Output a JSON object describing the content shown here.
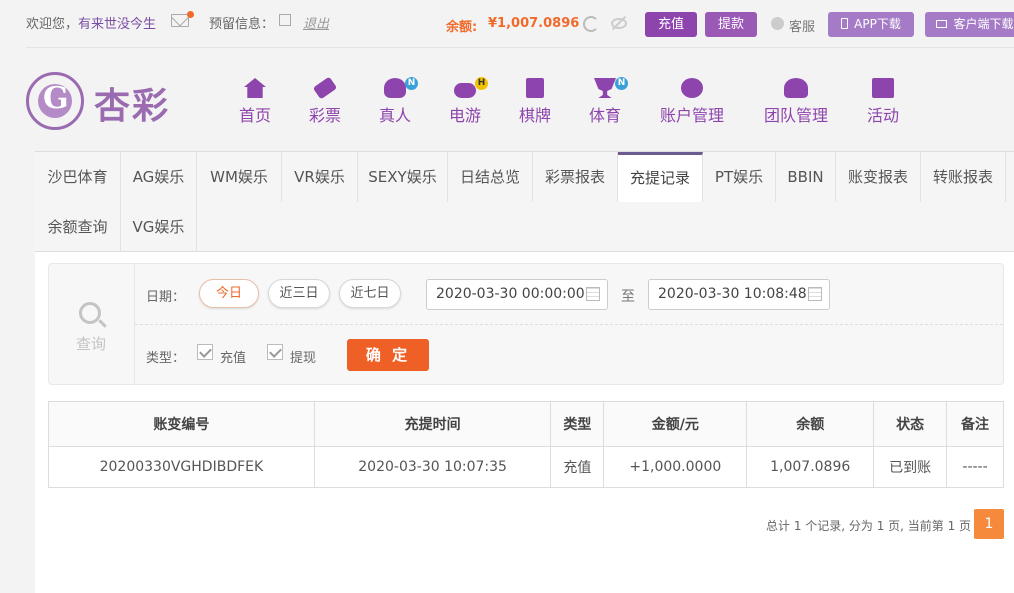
{
  "topbar": {
    "welcome": "欢迎您，",
    "username": "有来世没今生",
    "reserve_label": "预留信息：",
    "logout": "退出",
    "balance_label": "余额:",
    "balance_value": "¥1,007.0896",
    "recharge": "充值",
    "withdraw": "提款",
    "service": "客服",
    "app_download": "APP下载",
    "client_download": "客户端下载"
  },
  "logo": {
    "text": "杏彩"
  },
  "nav": [
    {
      "label": "首页",
      "icon": "home-icon"
    },
    {
      "label": "彩票",
      "icon": "lottery-ticket-icon"
    },
    {
      "label": "真人",
      "icon": "live-dealer-icon",
      "badge": "N"
    },
    {
      "label": "电游",
      "icon": "gamepad-icon",
      "badge": "H"
    },
    {
      "label": "棋牌",
      "icon": "cards-icon"
    },
    {
      "label": "体育",
      "icon": "trophy-icon",
      "badge": "N"
    },
    {
      "label": "账户管理",
      "icon": "yen-coin-icon"
    },
    {
      "label": "团队管理",
      "icon": "team-icon"
    },
    {
      "label": "活动",
      "icon": "gift-icon"
    }
  ],
  "tabs": [
    "沙巴体育",
    "AG娱乐",
    "WM娱乐",
    "VR娱乐",
    "SEXY娱乐",
    "日结总览",
    "彩票报表",
    "充提记录",
    "PT娱乐",
    "BBIN",
    "账变报表",
    "转账报表",
    "余额查询",
    "VG娱乐"
  ],
  "active_tab": "充提记录",
  "filter": {
    "query_label": "查询",
    "date_label": "日期：",
    "today": "今日",
    "three_days": "近三日",
    "seven_days": "近七日",
    "start": "2020-03-30 00:00:00",
    "to": "至",
    "end": "2020-03-30 10:08:48",
    "type_label": "类型：",
    "type_recharge": "充值",
    "type_withdraw": "提现",
    "confirm": "确 定"
  },
  "table": {
    "headers": [
      "账变编号",
      "充提时间",
      "类型",
      "金额/元",
      "余额",
      "状态",
      "备注"
    ],
    "rows": [
      [
        "20200330VGHDIBDFEK",
        "2020-03-30 10:07:35",
        "充值",
        "+1,000.0000",
        "1,007.0896",
        "已到账",
        "-----"
      ]
    ]
  },
  "pager": {
    "summary": "总计 1 个记录, 分为 1 页, 当前第 1 页",
    "current": "1"
  },
  "colors": {
    "brand_purple": "#8e44ad",
    "accent_orange": "#f06a2c",
    "success_green": "#3da43d",
    "amount_red": "#e03b3b"
  }
}
